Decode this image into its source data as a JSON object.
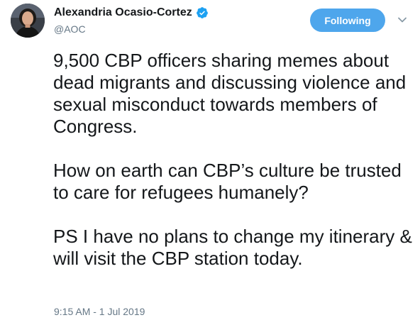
{
  "author": {
    "display_name": "Alexandria Ocasio-Cortez",
    "handle": "@AOC",
    "verified": true
  },
  "follow_button": {
    "label": "Following"
  },
  "tweet": {
    "paragraphs": [
      "9,500 CBP officers sharing memes about dead migrants and discussing violence and sexual misconduct towards members of Congress.",
      "How on earth can CBP’s culture be trusted to care for refugees humanely?",
      "PS I have no plans to change my itinerary & will visit the CBP station today."
    ],
    "timestamp": "9:15 AM - 1 Jul 2019"
  },
  "colors": {
    "follow_button_bg": "#4ea6ec",
    "verified_badge": "#1da1f2",
    "secondary_text": "#657786",
    "primary_text": "#14171a"
  },
  "icons": [
    "avatar-photo",
    "verified-badge-icon",
    "chevron-down-icon"
  ]
}
